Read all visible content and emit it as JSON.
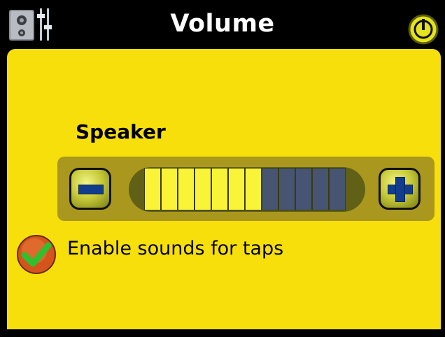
{
  "header": {
    "title": "Volume",
    "left_icon": "speaker-mixer-icon",
    "right_icon": "power-icon"
  },
  "volume": {
    "label": "Speaker",
    "level": 7,
    "max": 12,
    "minus_icon": "minus-icon",
    "plus_icon": "plus-icon"
  },
  "options": {
    "tap_sounds_label": "Enable sounds for taps",
    "tap_sounds_enabled": true,
    "check_icon": "checkmark-icon"
  },
  "colors": {
    "background": "#000000",
    "panel": "#f7df0c",
    "control_bar": "#a8951e",
    "segment_on": "#f9f438",
    "segment_off": "#475572",
    "button_glyph": "#123d8c",
    "check_circle": "#d4541c",
    "check_mark": "#2fbf2f"
  }
}
